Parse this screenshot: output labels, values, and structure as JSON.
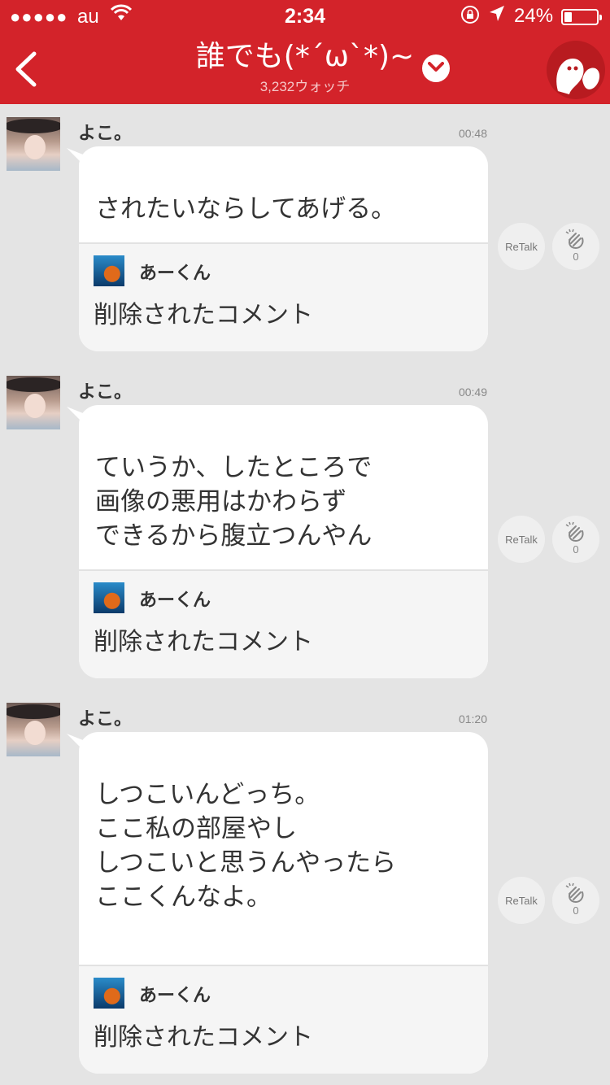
{
  "status_bar": {
    "signal": "●●●●●",
    "carrier": "au",
    "time": "2:34",
    "battery_pct": "24%",
    "battery_level": 0.24
  },
  "header": {
    "title": "誰でも(*´ω`*)~",
    "watch_count": "3,232ウォッチ"
  },
  "posts": [
    {
      "user": "よこ。",
      "time": "00:48",
      "message": "されたいならしてあげる。",
      "quote": {
        "user": "あーくん",
        "text": "削除されたコメント"
      },
      "retalk_label": "ReTalk",
      "clap_count": "0"
    },
    {
      "user": "よこ。",
      "time": "00:49",
      "message": "ていうか、したところで\n画像の悪用はかわらず\nできるから腹立つんやん",
      "quote": {
        "user": "あーくん",
        "text": "削除されたコメント"
      },
      "retalk_label": "ReTalk",
      "clap_count": "0"
    },
    {
      "user": "よこ。",
      "time": "01:20",
      "message": "しつこいんどっち。\nここ私の部屋やし\nしつこいと思うんやったら\nここくんなよ。",
      "quote": {
        "user": "あーくん",
        "text": "削除されたコメント"
      },
      "retalk_label": "ReTalk",
      "clap_count": "0"
    }
  ],
  "colors": {
    "header_bg": "#d3232a",
    "feed_bg": "#e4e4e4"
  }
}
